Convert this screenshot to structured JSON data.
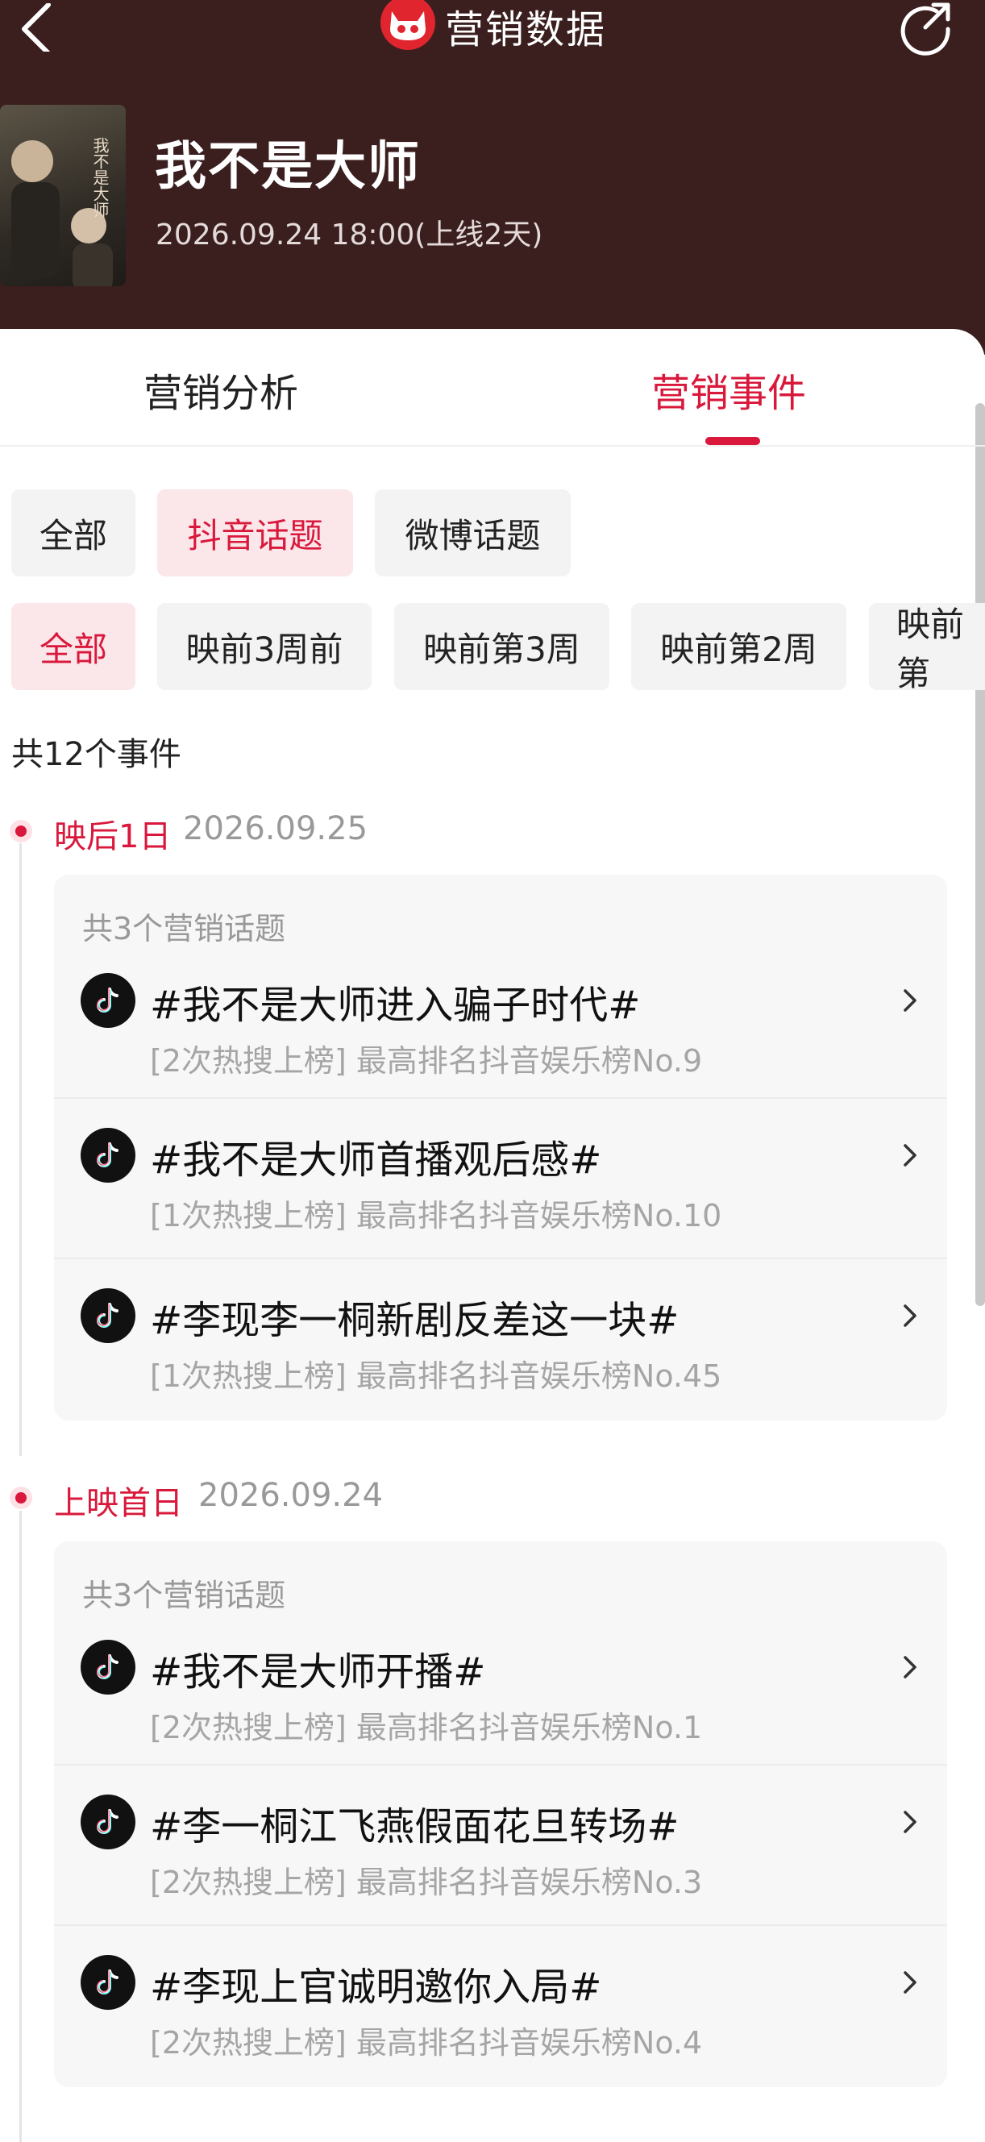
{
  "header": {
    "app_title": "营销数据",
    "movie_title": "我不是大师",
    "release_info": "2026.09.24 18:00(上线2天)",
    "poster_text": "我不是大师"
  },
  "tabs": [
    {
      "label": "营销分析",
      "active": false
    },
    {
      "label": "营销事件",
      "active": true
    }
  ],
  "source_filters": [
    {
      "label": "全部",
      "active": false
    },
    {
      "label": "抖音话题",
      "active": true
    },
    {
      "label": "微博话题",
      "active": false
    }
  ],
  "period_filters": [
    {
      "label": "全部",
      "active": true
    },
    {
      "label": "映前3周前",
      "active": false
    },
    {
      "label": "映前第3周",
      "active": false
    },
    {
      "label": "映前第2周",
      "active": false
    },
    {
      "label": "映前第",
      "active": false
    }
  ],
  "event_count": "共12个事件",
  "days": [
    {
      "label": "映后1日",
      "date": "2026.09.25",
      "group_title": "共3个营销话题",
      "topics": [
        {
          "name": "#我不是大师进入骗子时代#",
          "detail": "[2次热搜上榜] 最高排名抖音娱乐榜No.9"
        },
        {
          "name": "#我不是大师首播观后感#",
          "detail": "[1次热搜上榜] 最高排名抖音娱乐榜No.10"
        },
        {
          "name": "#李现李一桐新剧反差这一块#",
          "detail": "[1次热搜上榜] 最高排名抖音娱乐榜No.45"
        }
      ]
    },
    {
      "label": "上映首日",
      "date": "2026.09.24",
      "group_title": "共3个营销话题",
      "topics": [
        {
          "name": "#我不是大师开播#",
          "detail": "[2次热搜上榜] 最高排名抖音娱乐榜No.1"
        },
        {
          "name": "#李一桐江飞燕假面花旦转场#",
          "detail": "[2次热搜上榜] 最高排名抖音娱乐榜No.3"
        },
        {
          "name": "#李现上官诚明邀你入局#",
          "detail": "[2次热搜上榜] 最高排名抖音娱乐榜No.4"
        }
      ]
    }
  ],
  "colors": {
    "accent": "#d9183b",
    "header_bg": "#3b1f1f"
  },
  "icons": [
    "back-arrow-icon",
    "maoyan-cat-logo-icon",
    "share-icon",
    "tiktok-icon",
    "chevron-right-icon"
  ]
}
